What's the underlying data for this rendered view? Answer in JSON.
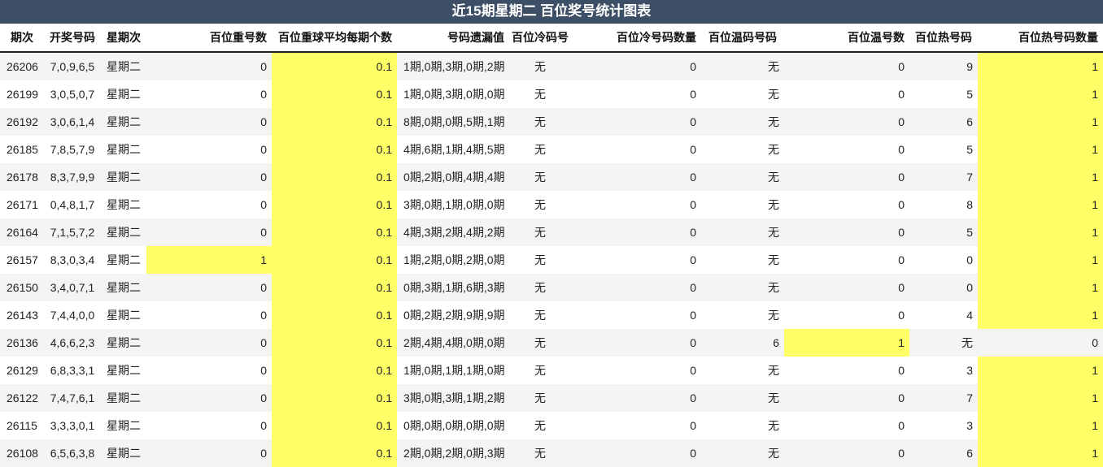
{
  "title": "近15期星期二 百位奖号统计图表",
  "columns": [
    "期次",
    "开奖号码",
    "星期次",
    "百位重号数",
    "百位重球平均每期个数",
    "号码遗漏值",
    "百位冷码号",
    "百位冷号码数量",
    "百位温码号码",
    "百位温号数",
    "百位热号码",
    "百位热号码数量"
  ],
  "highlight_color": "#ffff66",
  "header_color": "#3d4f66",
  "rows": [
    {
      "issue": "26206",
      "numbers": "7,0,9,6,5",
      "weekday": "星期二",
      "repeat": "0",
      "repeat_avg": "0.1",
      "miss": "1期,0期,3期,0期,2期",
      "cold": "无",
      "cold_count": "0",
      "warm": "无",
      "warm_count": "0",
      "hot": "9",
      "hot_count": "1"
    },
    {
      "issue": "26199",
      "numbers": "3,0,5,0,7",
      "weekday": "星期二",
      "repeat": "0",
      "repeat_avg": "0.1",
      "miss": "1期,0期,3期,0期,0期",
      "cold": "无",
      "cold_count": "0",
      "warm": "无",
      "warm_count": "0",
      "hot": "5",
      "hot_count": "1"
    },
    {
      "issue": "26192",
      "numbers": "3,0,6,1,4",
      "weekday": "星期二",
      "repeat": "0",
      "repeat_avg": "0.1",
      "miss": "8期,0期,0期,5期,1期",
      "cold": "无",
      "cold_count": "0",
      "warm": "无",
      "warm_count": "0",
      "hot": "6",
      "hot_count": "1"
    },
    {
      "issue": "26185",
      "numbers": "7,8,5,7,9",
      "weekday": "星期二",
      "repeat": "0",
      "repeat_avg": "0.1",
      "miss": "4期,6期,1期,4期,5期",
      "cold": "无",
      "cold_count": "0",
      "warm": "无",
      "warm_count": "0",
      "hot": "5",
      "hot_count": "1"
    },
    {
      "issue": "26178",
      "numbers": "8,3,7,9,9",
      "weekday": "星期二",
      "repeat": "0",
      "repeat_avg": "0.1",
      "miss": "0期,2期,0期,4期,4期",
      "cold": "无",
      "cold_count": "0",
      "warm": "无",
      "warm_count": "0",
      "hot": "7",
      "hot_count": "1"
    },
    {
      "issue": "26171",
      "numbers": "0,4,8,1,7",
      "weekday": "星期二",
      "repeat": "0",
      "repeat_avg": "0.1",
      "miss": "3期,0期,1期,0期,0期",
      "cold": "无",
      "cold_count": "0",
      "warm": "无",
      "warm_count": "0",
      "hot": "8",
      "hot_count": "1"
    },
    {
      "issue": "26164",
      "numbers": "7,1,5,7,2",
      "weekday": "星期二",
      "repeat": "0",
      "repeat_avg": "0.1",
      "miss": "4期,3期,2期,4期,2期",
      "cold": "无",
      "cold_count": "0",
      "warm": "无",
      "warm_count": "0",
      "hot": "5",
      "hot_count": "1"
    },
    {
      "issue": "26157",
      "numbers": "8,3,0,3,4",
      "weekday": "星期二",
      "repeat": "1",
      "repeat_avg": "0.1",
      "miss": "1期,2期,0期,2期,0期",
      "cold": "无",
      "cold_count": "0",
      "warm": "无",
      "warm_count": "0",
      "hot": "0",
      "hot_count": "1"
    },
    {
      "issue": "26150",
      "numbers": "3,4,0,7,1",
      "weekday": "星期二",
      "repeat": "0",
      "repeat_avg": "0.1",
      "miss": "0期,3期,1期,6期,3期",
      "cold": "无",
      "cold_count": "0",
      "warm": "无",
      "warm_count": "0",
      "hot": "0",
      "hot_count": "1"
    },
    {
      "issue": "26143",
      "numbers": "7,4,4,0,0",
      "weekday": "星期二",
      "repeat": "0",
      "repeat_avg": "0.1",
      "miss": "0期,2期,2期,9期,9期",
      "cold": "无",
      "cold_count": "0",
      "warm": "无",
      "warm_count": "0",
      "hot": "4",
      "hot_count": "1"
    },
    {
      "issue": "26136",
      "numbers": "4,6,6,2,3",
      "weekday": "星期二",
      "repeat": "0",
      "repeat_avg": "0.1",
      "miss": "2期,4期,4期,0期,0期",
      "cold": "无",
      "cold_count": "0",
      "warm": "6",
      "warm_count": "1",
      "hot": "无",
      "hot_count": "0"
    },
    {
      "issue": "26129",
      "numbers": "6,8,3,3,1",
      "weekday": "星期二",
      "repeat": "0",
      "repeat_avg": "0.1",
      "miss": "1期,0期,1期,1期,0期",
      "cold": "无",
      "cold_count": "0",
      "warm": "无",
      "warm_count": "0",
      "hot": "3",
      "hot_count": "1"
    },
    {
      "issue": "26122",
      "numbers": "7,4,7,6,1",
      "weekday": "星期二",
      "repeat": "0",
      "repeat_avg": "0.1",
      "miss": "3期,0期,3期,1期,2期",
      "cold": "无",
      "cold_count": "0",
      "warm": "无",
      "warm_count": "0",
      "hot": "7",
      "hot_count": "1"
    },
    {
      "issue": "26115",
      "numbers": "3,3,3,0,1",
      "weekday": "星期二",
      "repeat": "0",
      "repeat_avg": "0.1",
      "miss": "0期,0期,0期,0期,0期",
      "cold": "无",
      "cold_count": "0",
      "warm": "无",
      "warm_count": "0",
      "hot": "3",
      "hot_count": "1"
    },
    {
      "issue": "26108",
      "numbers": "6,5,6,3,8",
      "weekday": "星期二",
      "repeat": "0",
      "repeat_avg": "0.1",
      "miss": "2期,0期,2期,0期,3期",
      "cold": "无",
      "cold_count": "0",
      "warm": "无",
      "warm_count": "0",
      "hot": "6",
      "hot_count": "1"
    }
  ]
}
